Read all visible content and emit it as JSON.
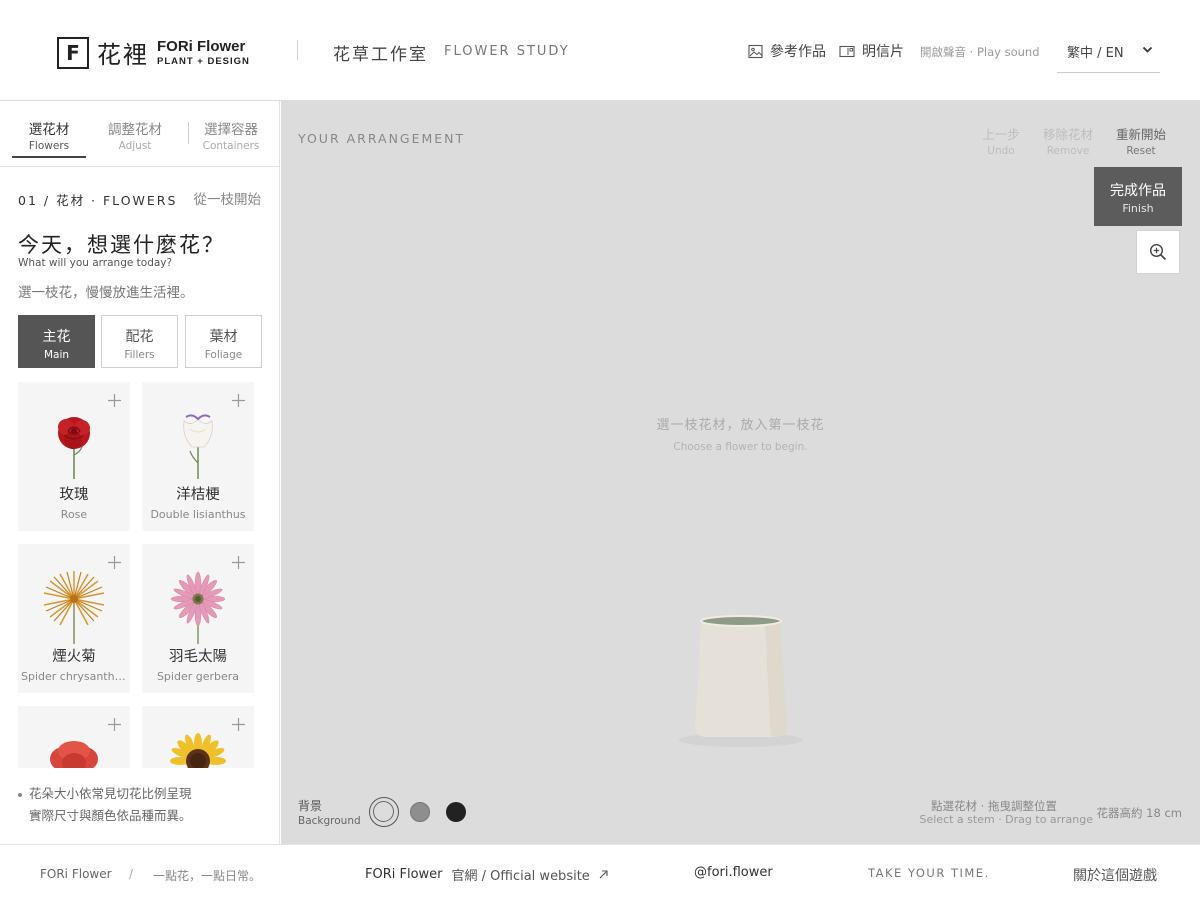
{
  "header": {
    "logo_mark": "F",
    "logo_cn": "花裡",
    "logo_en": "FORi Flower",
    "logo_sub": "PLANT + DESIGN",
    "studio_cn": "花草工作室",
    "studio_en": "FLOWER STUDY",
    "nav_reference": "參考作品",
    "nav_postcard": "明信片",
    "sound": "開啟聲音 · Play sound",
    "lang": "繁中 / EN"
  },
  "sidebar": {
    "tabs": [
      {
        "cn": "選花材",
        "en": "Flowers"
      },
      {
        "cn": "調整花材",
        "en": "Adjust"
      },
      {
        "cn": "選擇容器",
        "en": "Containers"
      }
    ],
    "step": "01 / 花材 · FLOWERS",
    "start_one": "從一枝開始",
    "question_cn": "今天，想選什麼花？",
    "question_en": "What will you arrange today?",
    "subtitle": "選一枝花，慢慢放進生活裡。",
    "categories": [
      {
        "cn": "主花",
        "en": "Main"
      },
      {
        "cn": "配花",
        "en": "Fillers"
      },
      {
        "cn": "葉材",
        "en": "Foliage"
      }
    ],
    "flowers": [
      {
        "cn": "玫瑰",
        "en": "Rose",
        "icon": "rose-icon"
      },
      {
        "cn": "洋桔梗",
        "en": "Double lisianthus",
        "icon": "lisianthus-icon"
      },
      {
        "cn": "煙火菊",
        "en": "Spider chrysanthemum",
        "icon": "chrysanthemum-icon"
      },
      {
        "cn": "羽毛太陽",
        "en": "Spider gerbera",
        "icon": "gerbera-icon"
      },
      {
        "cn": "",
        "en": "",
        "icon": "poppy-icon"
      },
      {
        "cn": "",
        "en": "",
        "icon": "sunflower-icon"
      }
    ],
    "note_line1": "花朵大小依常見切花比例呈現",
    "note_line2": "實際尺寸與顏色依品種而異。"
  },
  "canvas": {
    "label": "YOUR ARRANGEMENT",
    "undo_cn": "上一步",
    "undo_en": "Undo",
    "remove_cn": "移除花材",
    "remove_en": "Remove",
    "reset_cn": "重新開始",
    "reset_en": "Reset",
    "finish_cn": "完成作品",
    "finish_en": "Finish",
    "hint_cn": "選一枝花材，放入第一枝花",
    "hint_en": "Choose a flower to begin.",
    "bg_cn": "背景",
    "bg_en": "Background",
    "bg_colors": [
      "#dcdcdc",
      "#8e8e8e",
      "#222222"
    ],
    "select_cn": "點選花材 · 拖曳調整位置",
    "select_en": "Select a stem · Drag to arrange",
    "vase_height": "花器高約 18 cm"
  },
  "footer": {
    "brand": "FORi Flower",
    "slash": "/",
    "tagline": "一點花，一點日常。",
    "site_brand": "FORi Flower",
    "site_label": "官網 / Official website",
    "instagram": "@fori.flower",
    "take_time": "TAKE YOUR TIME.",
    "about": "關於這個遊戲"
  }
}
